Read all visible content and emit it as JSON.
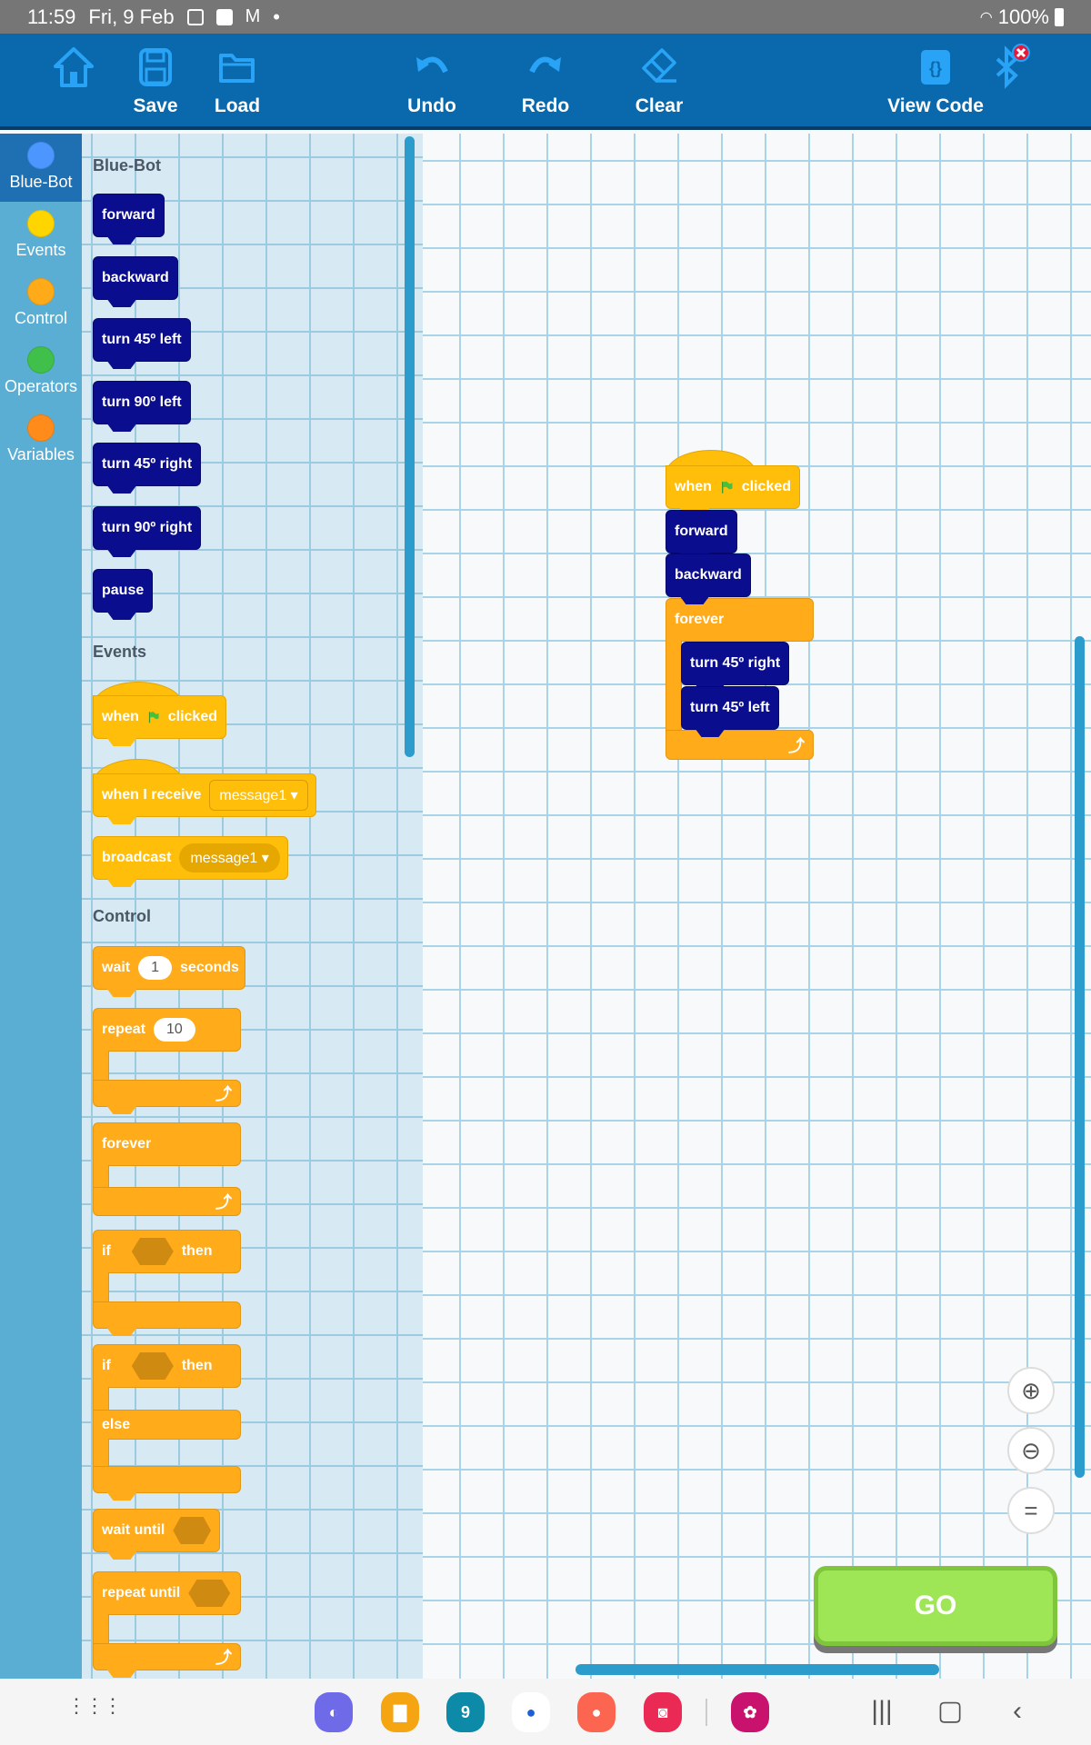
{
  "status_bar": {
    "time": "11:59",
    "date": "Fri, 9 Feb",
    "battery": "100%",
    "icons": [
      "gallery-icon",
      "checkbox-icon",
      "gmail-icon",
      "dot-icon",
      "wifi-icon",
      "battery-icon"
    ]
  },
  "toolbar": {
    "items": [
      {
        "label": "",
        "icon": "home-icon"
      },
      {
        "label": "Save",
        "icon": "save-icon"
      },
      {
        "label": "Load",
        "icon": "folder-icon"
      },
      {
        "label": "Undo",
        "icon": "undo-icon"
      },
      {
        "label": "Redo",
        "icon": "redo-icon"
      },
      {
        "label": "Clear",
        "icon": "eraser-icon"
      },
      {
        "label": "View Code",
        "icon": "code-icon"
      },
      {
        "label": "",
        "icon": "bluetooth-disconnected-icon"
      }
    ],
    "icon_color": "#29a3f5",
    "bg": "#0a69ad"
  },
  "categories": [
    {
      "label": "Blue-Bot",
      "color": "#4c97ff",
      "selected": true
    },
    {
      "label": "Events",
      "color": "#ffd500"
    },
    {
      "label": "Control",
      "color": "#ffab19"
    },
    {
      "label": "Operators",
      "color": "#40bf4a"
    },
    {
      "label": "Variables",
      "color": "#ff8c1a"
    }
  ],
  "palette": {
    "bluebot_header": "Blue-Bot",
    "bluebot_blocks": [
      "forward",
      "backward",
      "turn 45º left",
      "turn 90º left",
      "turn 45º right",
      "turn 90º right",
      "pause"
    ],
    "events_header": "Events",
    "events": {
      "when": "when",
      "clicked": "clicked",
      "when_receive": "when I receive",
      "message": "message1",
      "broadcast": "broadcast"
    },
    "control_header": "Control",
    "control": {
      "wait": "wait",
      "wait_value": "1",
      "seconds": "seconds",
      "repeat": "repeat",
      "repeat_value": "10",
      "forever": "forever",
      "if": "if",
      "then": "then",
      "else": "else",
      "wait_until": "wait until",
      "repeat_until": "repeat until"
    }
  },
  "workspace": {
    "script": {
      "hat_when": "when",
      "hat_clicked": "clicked",
      "b1": "forward",
      "b2": "backward",
      "loop": "forever",
      "inner1": "turn 45º right",
      "inner2": "turn 45º left"
    }
  },
  "zoom_controls": [
    "zoom-in-icon",
    "zoom-out-icon",
    "zoom-reset-icon"
  ],
  "go_label": "GO",
  "nav": {
    "calendar_day": "9"
  },
  "colors": {
    "motion": "#0a0d8e",
    "events": "#ffbe0a",
    "control": "#ffab1a",
    "go": "#9ee655"
  }
}
